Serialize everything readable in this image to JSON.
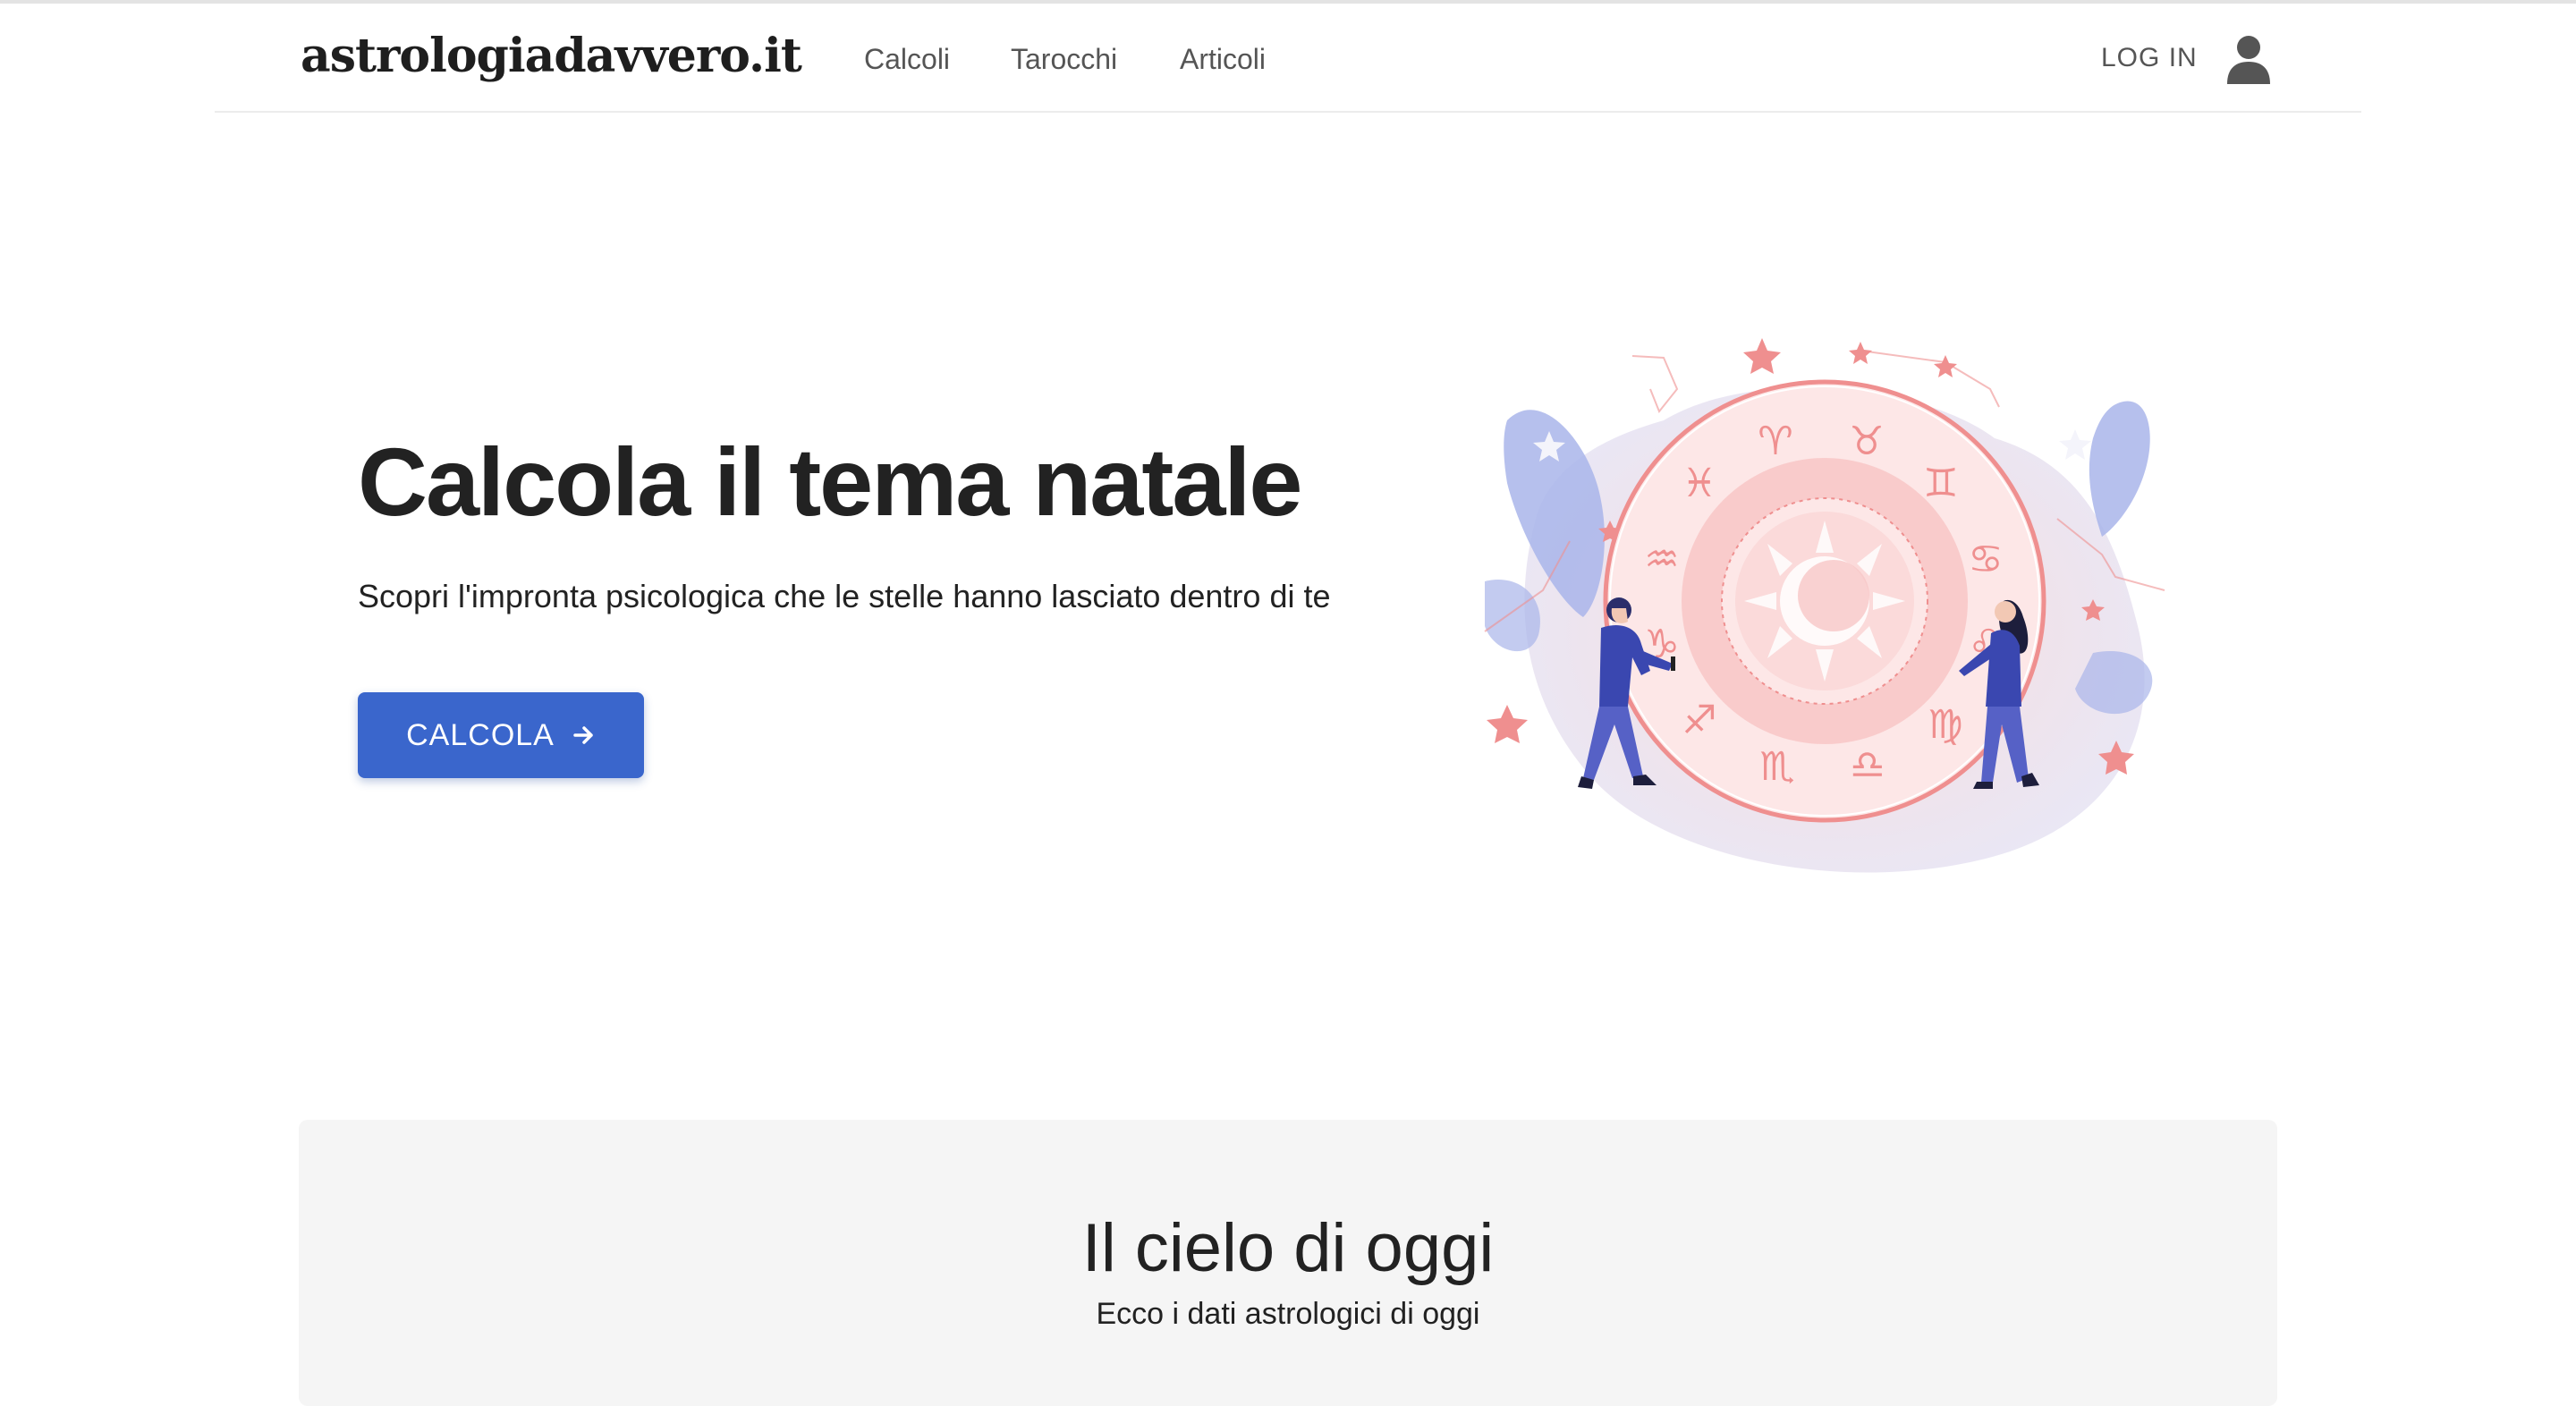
{
  "header": {
    "logo": "astrologiadavvero.it",
    "nav": [
      "Calcoli",
      "Tarocchi",
      "Articoli"
    ],
    "login": "LOG IN"
  },
  "hero": {
    "title": "Calcola il tema natale",
    "subtitle": "Scopri l'impronta psicologica che le stelle hanno lasciato dentro di te",
    "cta": "CALCOLA"
  },
  "illustration": {
    "zodiac_signs": [
      "♓",
      "♈",
      "♉",
      "♊",
      "♋",
      "♌",
      "♍",
      "♎",
      "♏",
      "♐",
      "♑",
      "♒"
    ]
  },
  "sky": {
    "title": "Il cielo di oggi",
    "subtitle": "Ecco i dati astrologici di oggi"
  },
  "colors": {
    "primary": "#3a66cc",
    "coral": "#ef8f8f",
    "lavender": "#a9b5ea"
  }
}
